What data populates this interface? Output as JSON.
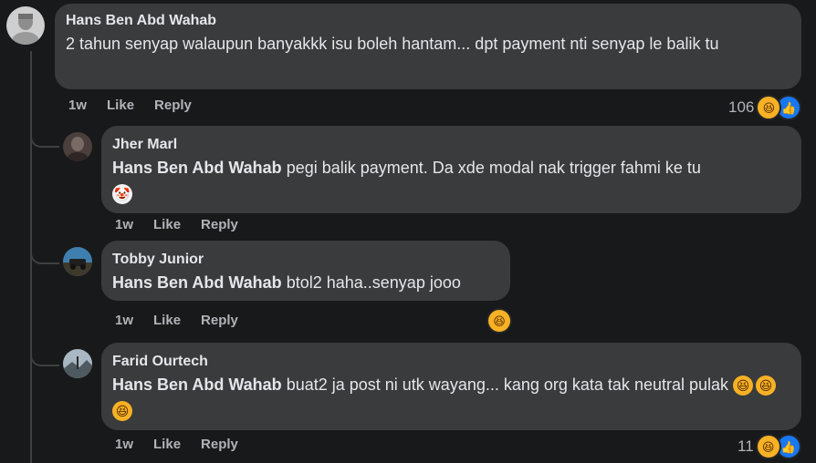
{
  "comments": [
    {
      "author": "Hans Ben Abd Wahab",
      "mention": "",
      "text": "2 tahun senyap walaupun banyakkk isu boleh hantam... dpt payment nti senyap le balik tu",
      "time": "1w",
      "like_label": "Like",
      "reply_label": "Reply",
      "reaction_count": "106"
    },
    {
      "author": "Jher Marl",
      "mention": "Hans Ben Abd Wahab",
      "text": "pegi balik payment. Da xde modal nak trigger fahmi ke tu",
      "time": "1w",
      "like_label": "Like",
      "reply_label": "Reply",
      "reaction_count": ""
    },
    {
      "author": "Tobby Junior",
      "mention": "Hans Ben Abd Wahab",
      "text": "btol2 haha..senyap jooo",
      "time": "1w",
      "like_label": "Like",
      "reply_label": "Reply",
      "reaction_count": ""
    },
    {
      "author": "Farid Ourtech",
      "mention": "Hans Ben Abd Wahab",
      "text": "buat2 ja post ni utk wayang... kang org kata tak neutral pulak",
      "time": "1w",
      "like_label": "Like",
      "reply_label": "Reply",
      "reaction_count": "11"
    }
  ],
  "icons": {
    "haha": "haha-reaction-icon",
    "like": "like-reaction-icon",
    "clown": "clown-emoji",
    "grin": "grinning-squinting-emoji"
  },
  "colors": {
    "background": "#18191a",
    "bubble": "#3a3b3c",
    "secondary_text": "#b0b3b8",
    "like_blue": "#1877f2",
    "haha_yellow": "#f7b125"
  }
}
